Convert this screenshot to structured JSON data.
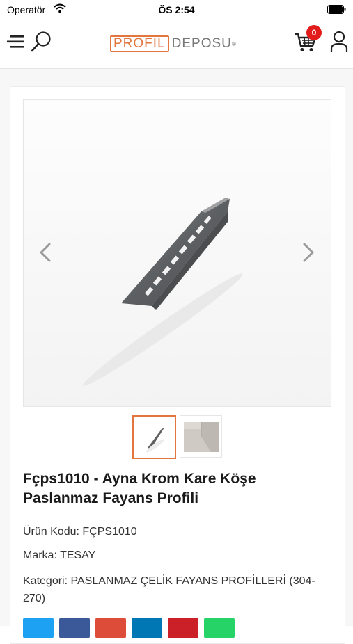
{
  "status_bar": {
    "carrier": "Operatör",
    "time": "ÖS 2:54"
  },
  "header": {
    "logo_part1": "PROFIL",
    "logo_part2": "DEPOSU",
    "logo_mark": "®",
    "cart_count": "0"
  },
  "product": {
    "title": "Fçps1010 - Ayna Krom Kare Köşe Paslanmaz Fayans Profili",
    "code_label": "Ürün Kodu:",
    "code_value": "FÇPS1010",
    "brand_label": "Marka:",
    "brand_value": "TESAY",
    "category_label": "Kategori:",
    "category_value": "PASLANMAZ ÇELİK FAYANS PROFİLLERİ (304-270)"
  },
  "colors": {
    "accent": "#e2763e",
    "badge": "#e21b1b",
    "share_twitter": "#1da1f2",
    "share_facebook": "#3b5998",
    "share_google": "#dd4b39",
    "share_linkedin": "#0077b5",
    "share_pinterest": "#cb2027",
    "share_whatsapp": "#25d366"
  },
  "icons": [
    "menu-icon",
    "search-icon",
    "cart-icon",
    "user-icon",
    "chevron-left-icon",
    "chevron-right-icon",
    "wifi-icon",
    "battery-icon"
  ]
}
